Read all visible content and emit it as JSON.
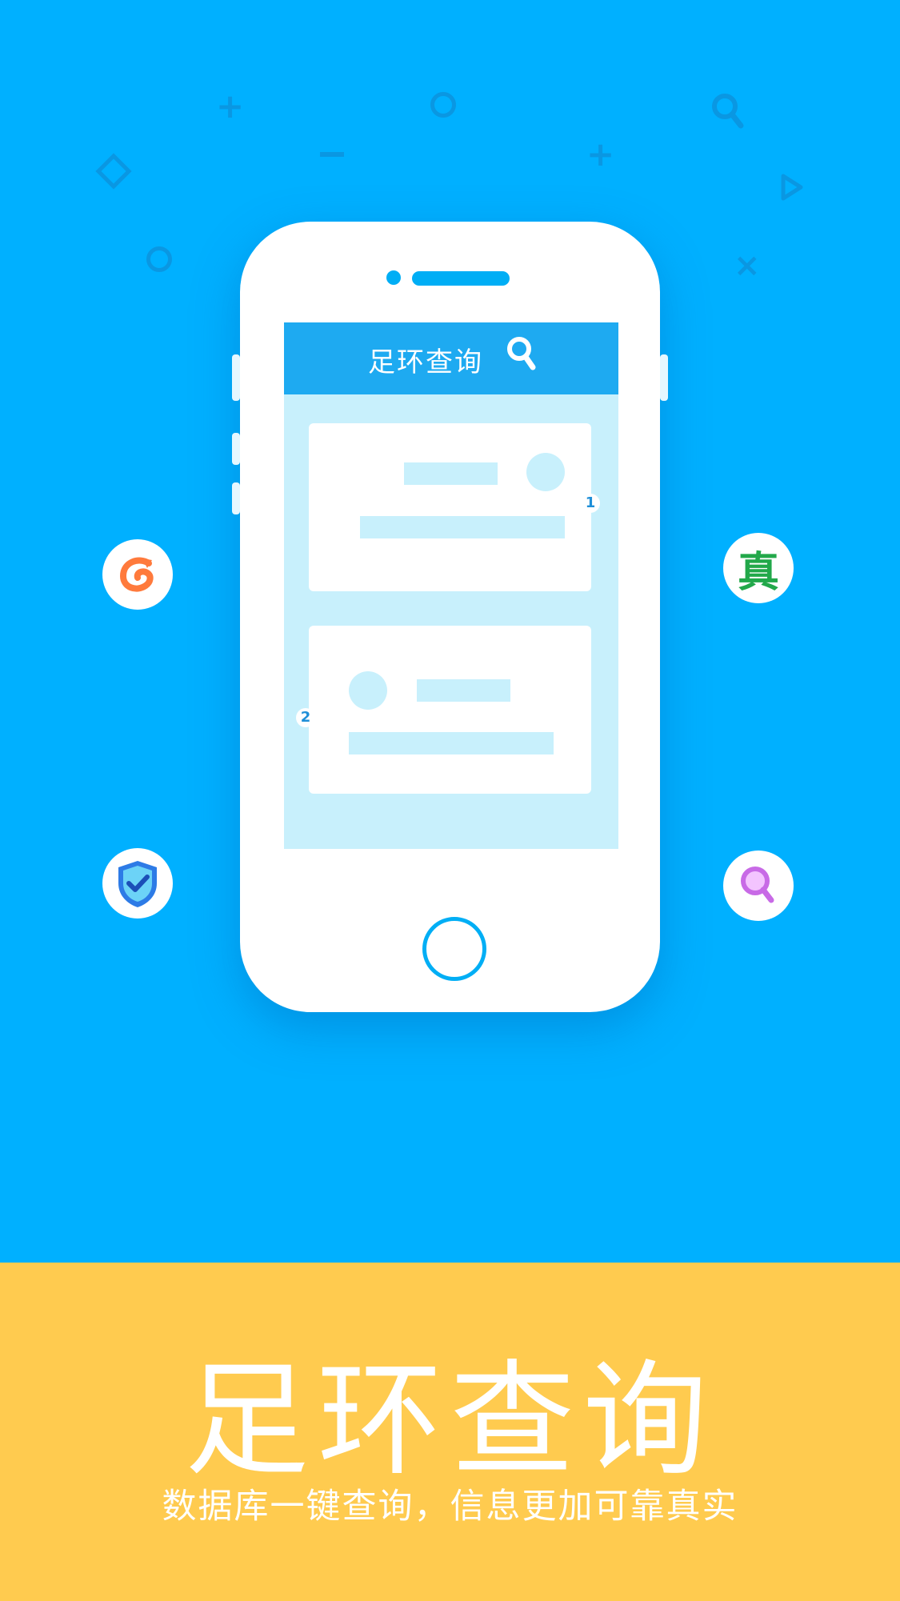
{
  "colors": {
    "background": "#00b0ff",
    "phone_screen_header": "#1eaaf1",
    "phone_screen_bg": "#c8f0fc",
    "bottom_band": "#ffcb4f",
    "accent_blue": "#00aef5"
  },
  "phone": {
    "screen_title": "足环查询",
    "search_icon": "search-icon",
    "card_markers": [
      "1",
      "2"
    ]
  },
  "app_icons": [
    {
      "name": "dragon-logo-icon"
    },
    {
      "name": "shield-check-icon"
    },
    {
      "text": "真",
      "name": "zhen-character-icon"
    },
    {
      "name": "magnifier-icon"
    }
  ],
  "banner": {
    "title": "足环查询",
    "subtitle": "数据库一键查询，信息更加可靠真实"
  }
}
